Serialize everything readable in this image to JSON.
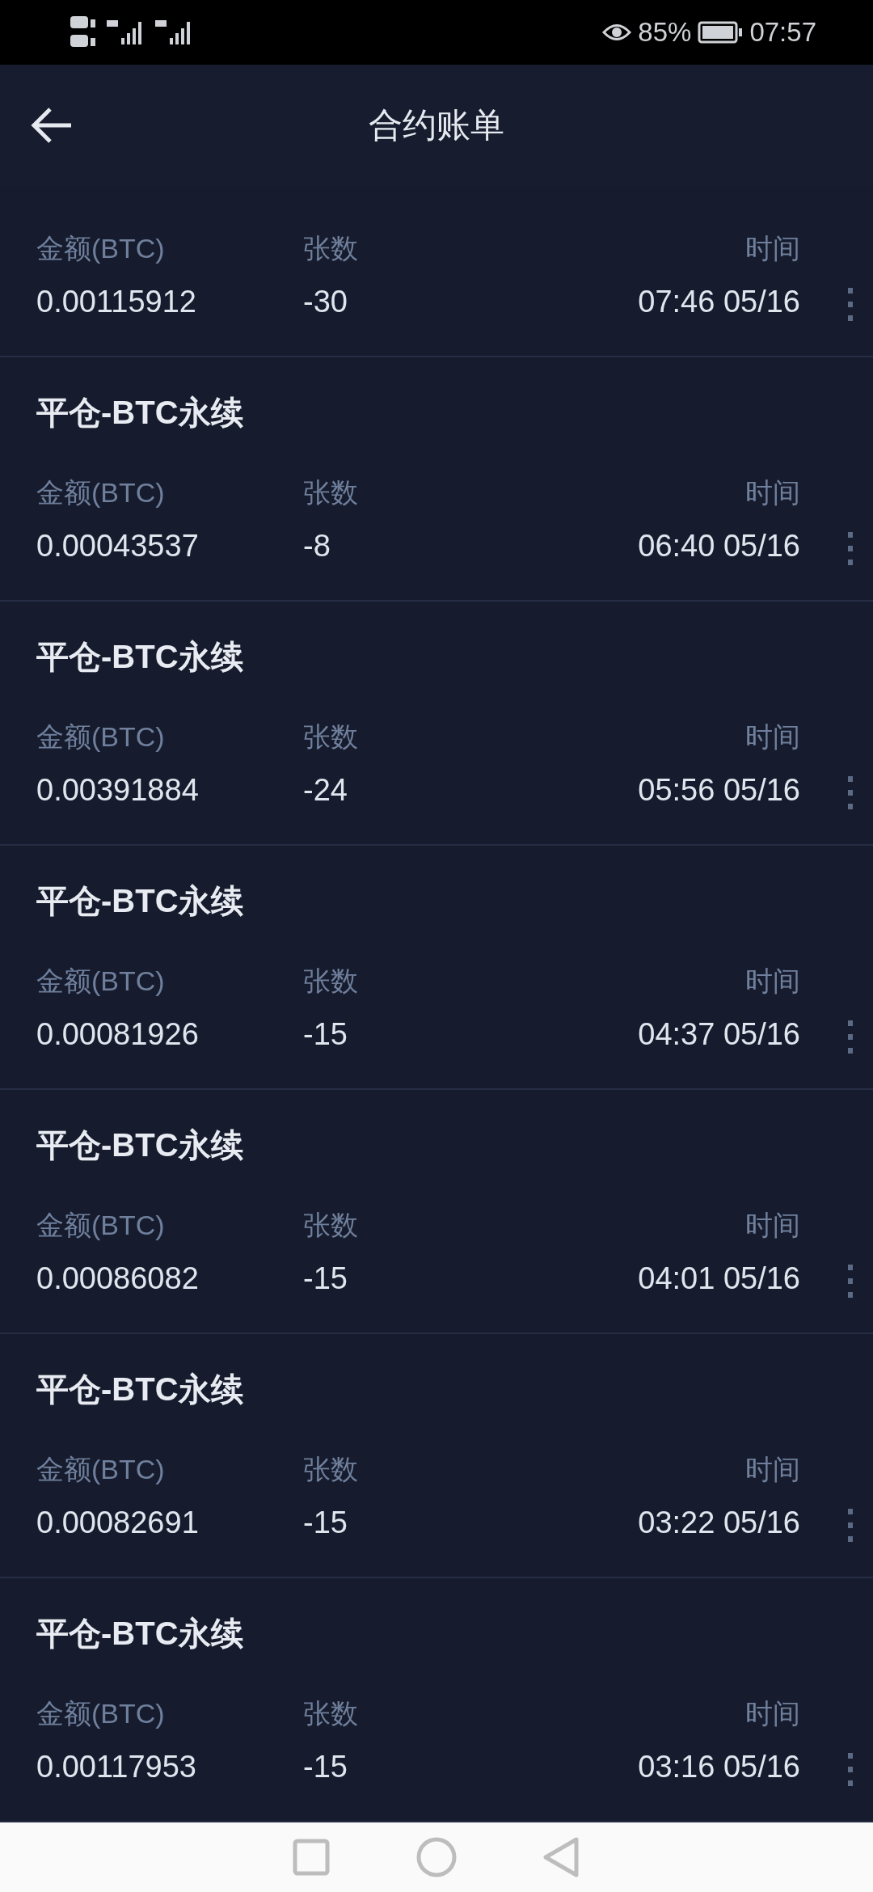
{
  "status_bar": {
    "battery_percent": "85%",
    "time": "07:57"
  },
  "header": {
    "title": "合约账单"
  },
  "records": [
    {
      "amount_label": "金额(BTC)",
      "amount": "0.00115912",
      "count_label": "张数",
      "count": "-30",
      "time_label": "时间",
      "time": "07:46 05/16"
    },
    {
      "title": "平仓-BTC永续",
      "amount_label": "金额(BTC)",
      "amount": "0.00043537",
      "count_label": "张数",
      "count": "-8",
      "time_label": "时间",
      "time": "06:40 05/16"
    },
    {
      "title": "平仓-BTC永续",
      "amount_label": "金额(BTC)",
      "amount": "0.00391884",
      "count_label": "张数",
      "count": "-24",
      "time_label": "时间",
      "time": "05:56 05/16"
    },
    {
      "title": "平仓-BTC永续",
      "amount_label": "金额(BTC)",
      "amount": "0.00081926",
      "count_label": "张数",
      "count": "-15",
      "time_label": "时间",
      "time": "04:37 05/16"
    },
    {
      "title": "平仓-BTC永续",
      "amount_label": "金额(BTC)",
      "amount": "0.00086082",
      "count_label": "张数",
      "count": "-15",
      "time_label": "时间",
      "time": "04:01 05/16"
    },
    {
      "title": "平仓-BTC永续",
      "amount_label": "金额(BTC)",
      "amount": "0.00082691",
      "count_label": "张数",
      "count": "-15",
      "time_label": "时间",
      "time": "03:22 05/16"
    },
    {
      "title": "平仓-BTC永续",
      "amount_label": "金额(BTC)",
      "amount": "0.00117953",
      "count_label": "张数",
      "count": "-15",
      "time_label": "时间",
      "time": "03:16 05/16"
    }
  ]
}
